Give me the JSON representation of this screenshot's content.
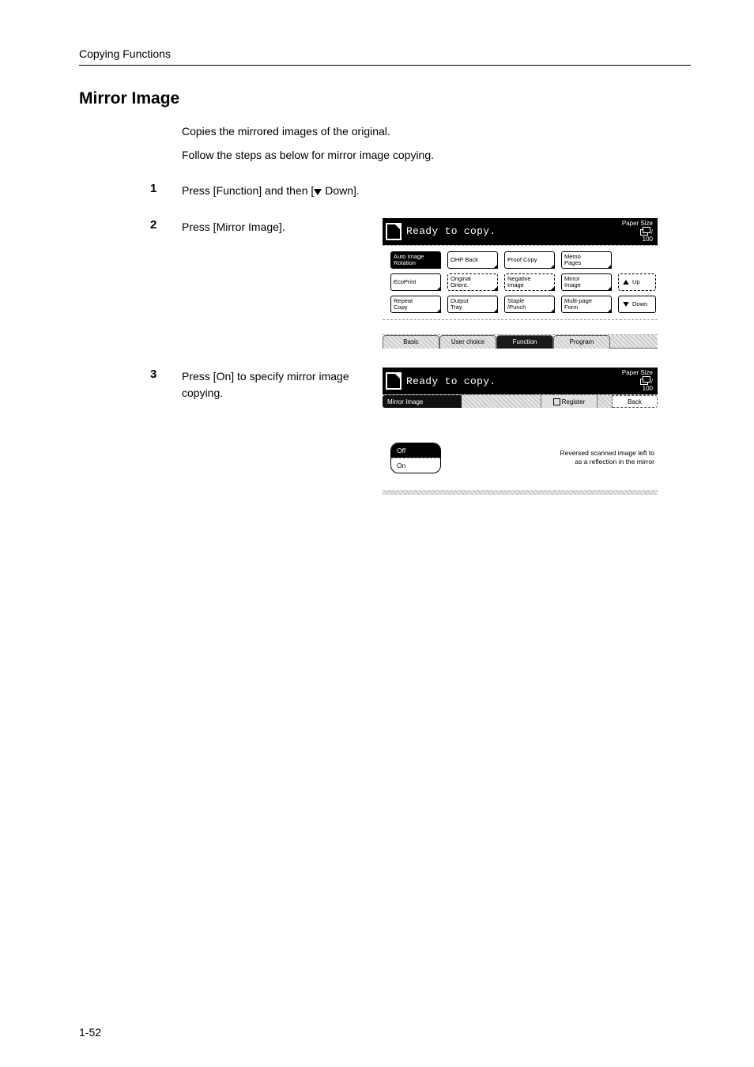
{
  "running_head": "Copying Functions",
  "section_title": "Mirror Image",
  "intro_line1": "Copies the mirrored images of the original.",
  "intro_line2": "Follow the steps as below for mirror image copying.",
  "steps": {
    "s1": {
      "num": "1",
      "text_a": "Press [Function] and then [",
      "text_b": " Down]."
    },
    "s2": {
      "num": "2",
      "text": "Press [Mirror Image]."
    },
    "s3": {
      "num": "3",
      "text": "Press [On] to specify mirror image copying."
    }
  },
  "panel1": {
    "ready": "Ready to copy.",
    "paper_size": "Paper Size",
    "count": "100",
    "grid": {
      "r1": [
        "Auto Image\nRotation",
        "OHP Back",
        "Proof Copy",
        "Memo\nPages"
      ],
      "r2": [
        "EcoPrint",
        "Original\nOrient.",
        "Negative\nImage",
        "Mirror\nImage"
      ],
      "r3": [
        "Repeat\nCopy",
        "Output\nTray",
        "Staple\n/Punch",
        "Multi-page\nForm"
      ]
    },
    "nav_up": "Up",
    "nav_down": "Down",
    "tabs": [
      "Basic",
      "User choice",
      "Function",
      "Program"
    ]
  },
  "panel2": {
    "ready": "Ready to copy.",
    "paper_size": "Paper Size",
    "count": "100",
    "crumb": "Mirror Image",
    "register": "Register",
    "back": "Back",
    "opt_off": "Off",
    "opt_on": "On",
    "hint_l1": "Reversed scanned image left to",
    "hint_l2": "as a reflection in the mirror"
  },
  "page_number": "1-52"
}
